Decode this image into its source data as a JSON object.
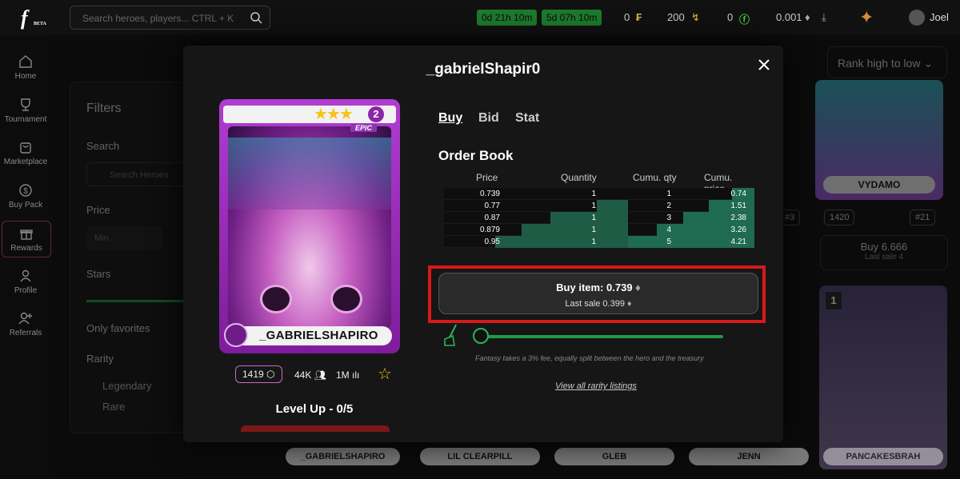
{
  "topbar": {
    "logo_text": "f",
    "logo_sub": "BETA",
    "search_placeholder": "Search heroes, players... CTRL + K",
    "timers": [
      "0d 21h 10m",
      "5d 07h 10m"
    ],
    "stats": [
      "0",
      "200",
      "0",
      "0.001"
    ],
    "username": "Joel"
  },
  "sidebar": {
    "items": [
      {
        "label": "Home",
        "icon": "home-icon"
      },
      {
        "label": "Tournament",
        "icon": "trophy-icon"
      },
      {
        "label": "Marketplace",
        "icon": "bag-icon"
      },
      {
        "label": "Buy Pack",
        "icon": "coin-icon"
      },
      {
        "label": "Rewards",
        "icon": "gift-icon"
      },
      {
        "label": "Profile",
        "icon": "user-icon"
      },
      {
        "label": "Referrals",
        "icon": "add-user-icon"
      }
    ]
  },
  "background": {
    "filters_title": "Filters",
    "search_label": "Search",
    "search_placeholder": "Search Heroes",
    "price_label": "Price",
    "min_placeholder": "Min",
    "stars_label": "Stars",
    "favorites_label": "Only favorites",
    "rarity_label": "Rarity",
    "rarities": [
      "Legendary",
      "Rare"
    ],
    "sort": "Rank high to low",
    "card_names": [
      "_GABRIELSHAPIRO",
      "LIL CLEARPILL",
      "GLEB",
      "JENN",
      "PANCAKESBRAH"
    ],
    "right_card_name": "VYDAMO",
    "right_card_score": "1420",
    "right_card_rank": "#21",
    "right_card_rank_left": "#3",
    "right_card_buy": "Buy 6.666",
    "right_card_last": "Last sale 4",
    "right_card_level": "1"
  },
  "modal": {
    "title": "_gabrielShapir0",
    "card": {
      "name": "_GABRIELSHAPIRO",
      "rarity": "EPIC",
      "level": "2",
      "stars": "★★★"
    },
    "card_stats": {
      "score": "1419",
      "followers": "44K",
      "views": "1M"
    },
    "level_up": "Level Up - 0/5",
    "tabs": [
      "Buy",
      "Bid",
      "Stat"
    ],
    "order_book_title": "Order Book",
    "order_book": {
      "headers": [
        "Price",
        "Quantity",
        "Cumu. qty",
        "Cumu. price"
      ],
      "rows": [
        {
          "price": "0.739",
          "qty": "1",
          "cumu_qty": "1",
          "cumu_price": "0.74",
          "depth": 0.0,
          "cdepth": 0.176
        },
        {
          "price": "0.77",
          "qty": "1",
          "cumu_qty": "2",
          "cumu_price": "1.51",
          "depth": 0.17,
          "cdepth": 0.359
        },
        {
          "price": "0.87",
          "qty": "1",
          "cumu_qty": "3",
          "cumu_price": "2.38",
          "depth": 0.42,
          "cdepth": 0.565
        },
        {
          "price": "0.879",
          "qty": "1",
          "cumu_qty": "4",
          "cumu_price": "3.26",
          "depth": 0.58,
          "cdepth": 0.774
        },
        {
          "price": "0.95",
          "qty": "1",
          "cumu_qty": "5",
          "cumu_price": "4.21",
          "depth": 0.72,
          "cdepth": 1.0
        }
      ]
    },
    "buy_button": "Buy item: 0.739",
    "last_sale": "Last sale 0.399",
    "fee_note": "Fantasy takes a 3% fee, equally split between the hero and the treasury",
    "view_all": "View all rarity listings"
  }
}
